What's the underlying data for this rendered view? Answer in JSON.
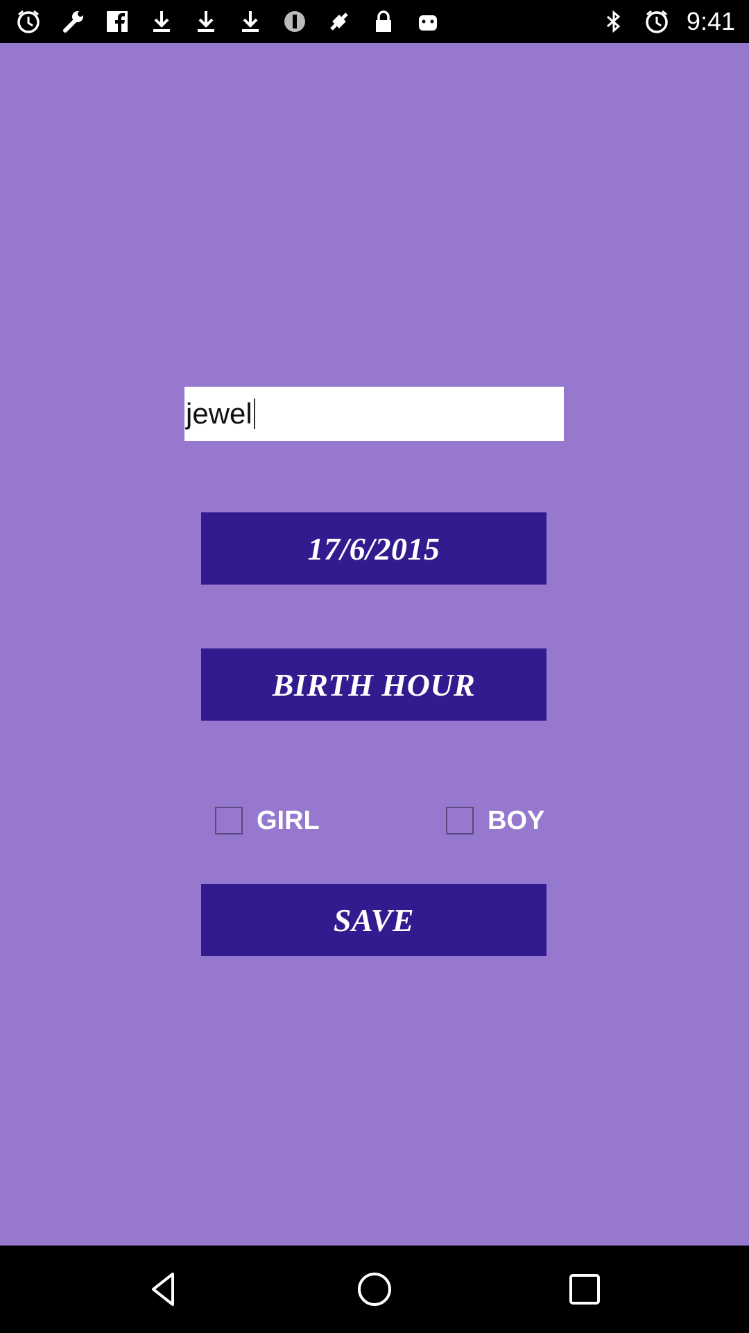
{
  "status_bar": {
    "time": "9:41",
    "left_icons": [
      "alarm-icon",
      "wrench-icon",
      "facebook-icon",
      "download-icon",
      "download-icon",
      "download-icon",
      "info-icon",
      "fake-gps-icon",
      "lock-icon",
      "android-icon"
    ],
    "right_icons": [
      "bluetooth-icon",
      "alarm-icon"
    ]
  },
  "form": {
    "name_value": "jewel",
    "date_label": "17/6/2015",
    "birth_hour_label": "BIRTH HOUR",
    "girl_label": "GIRL",
    "girl_checked": false,
    "boy_label": "BOY",
    "boy_checked": false,
    "save_label": "SAVE"
  },
  "colors": {
    "background": "#9679cf",
    "button": "#321b8f",
    "button_text": "#ffffff",
    "input_bg": "#ffffff"
  },
  "nav_bar": {
    "icons": [
      "back-icon",
      "home-icon",
      "recents-icon"
    ]
  }
}
